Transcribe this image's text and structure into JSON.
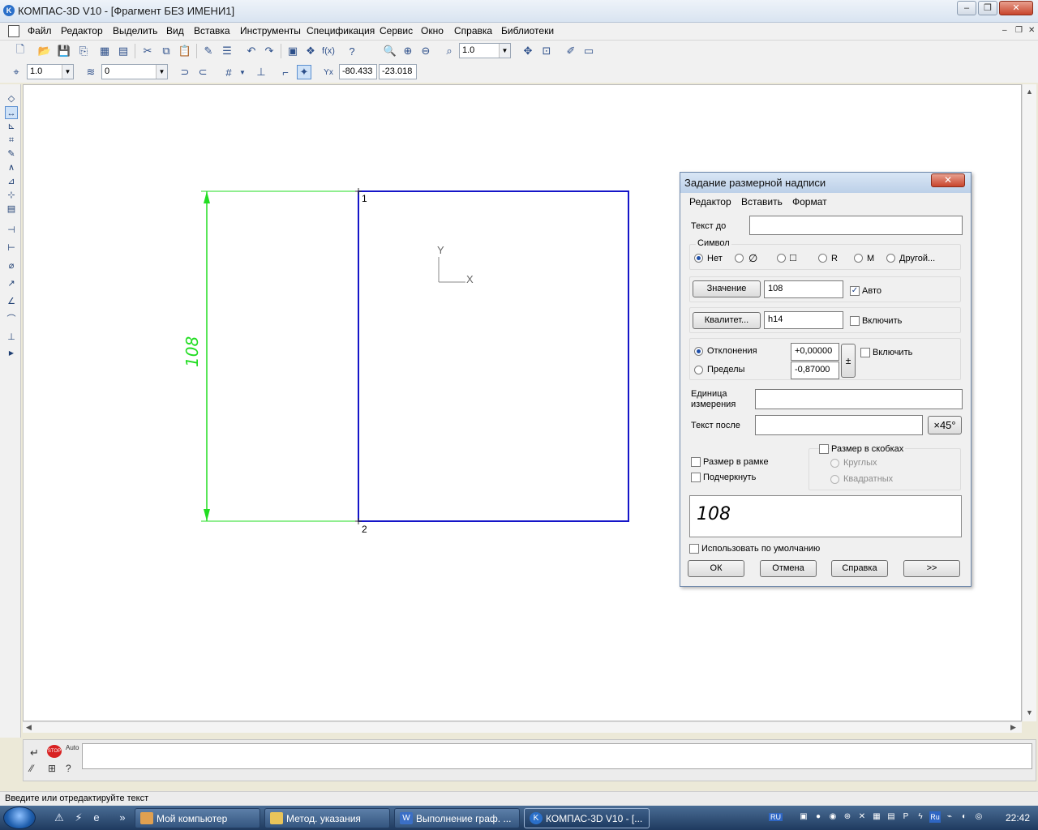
{
  "window": {
    "title": "КОМПАС-3D V10 - [Фрагмент БЕЗ ИМЕНИ1]",
    "app_icon": "K"
  },
  "menu": {
    "items": [
      "Файл",
      "Редактор",
      "Выделить",
      "Вид",
      "Вставка",
      "Инструменты",
      "Спецификация",
      "Сервис",
      "Окно",
      "Справка",
      "Библиотеки"
    ]
  },
  "toolbar": {
    "zoom_value": "1.0",
    "step_value": "1.0",
    "layer_value": "0",
    "coord_x": "-80.433",
    "coord_y": "-23.018"
  },
  "drawing": {
    "dimension_value": "108",
    "point1_label": "1",
    "point2_label": "2",
    "axis_x": "X",
    "axis_y": "Y",
    "colors": {
      "rect": "#1515c8",
      "dimension": "#22dd22",
      "axes": "#888888"
    }
  },
  "dialog": {
    "title": "Задание размерной надписи",
    "close_icon": "✕",
    "menu": [
      "Редактор",
      "Вставить",
      "Формат"
    ],
    "text_before_label": "Текст до",
    "text_before_value": "",
    "symbol_group": "Символ",
    "symbols": [
      "Нет",
      "∅",
      "□",
      "R",
      "M",
      "Другой..."
    ],
    "value_button": "Значение",
    "value": "108",
    "auto_label": "Авто",
    "quality_button": "Квалитет...",
    "quality_value": "h14",
    "quality_enable": "Включить",
    "deviations_label": "Отклонения",
    "limits_label": "Пределы",
    "dev_upper": "+0,00000",
    "dev_lower": "-0,87000",
    "pm_symbol": "±",
    "dev_enable": "Включить",
    "unit_label_1": "Единица",
    "unit_label_2": "измерения",
    "unit_value": "",
    "text_after_label": "Текст после",
    "text_after_value": "",
    "chamfer_button": "×45°",
    "framed_label": "Размер в рамке",
    "underline_label": "Подчеркнуть",
    "brackets_label": "Размер в скобках",
    "round_label": "Круглых",
    "square_label": "Квадратных",
    "preview_text": "108",
    "default_label": "Использовать по умолчанию",
    "ok_button": "ОК",
    "cancel_button": "Отмена",
    "help_button": "Справка",
    "more_button": ">>"
  },
  "propbar": {
    "auto_label": "Auto",
    "stop_label": "STOP"
  },
  "status": {
    "text": "Введите или отредактируйте текст"
  },
  "taskbar": {
    "buttons": [
      "Мой компьютер",
      "Метод. указания",
      "Выполнение граф. ...",
      "КОМПАС-3D V10 - [..."
    ],
    "lang": "RU",
    "tray_lang": "Ru",
    "time": "22:42"
  }
}
